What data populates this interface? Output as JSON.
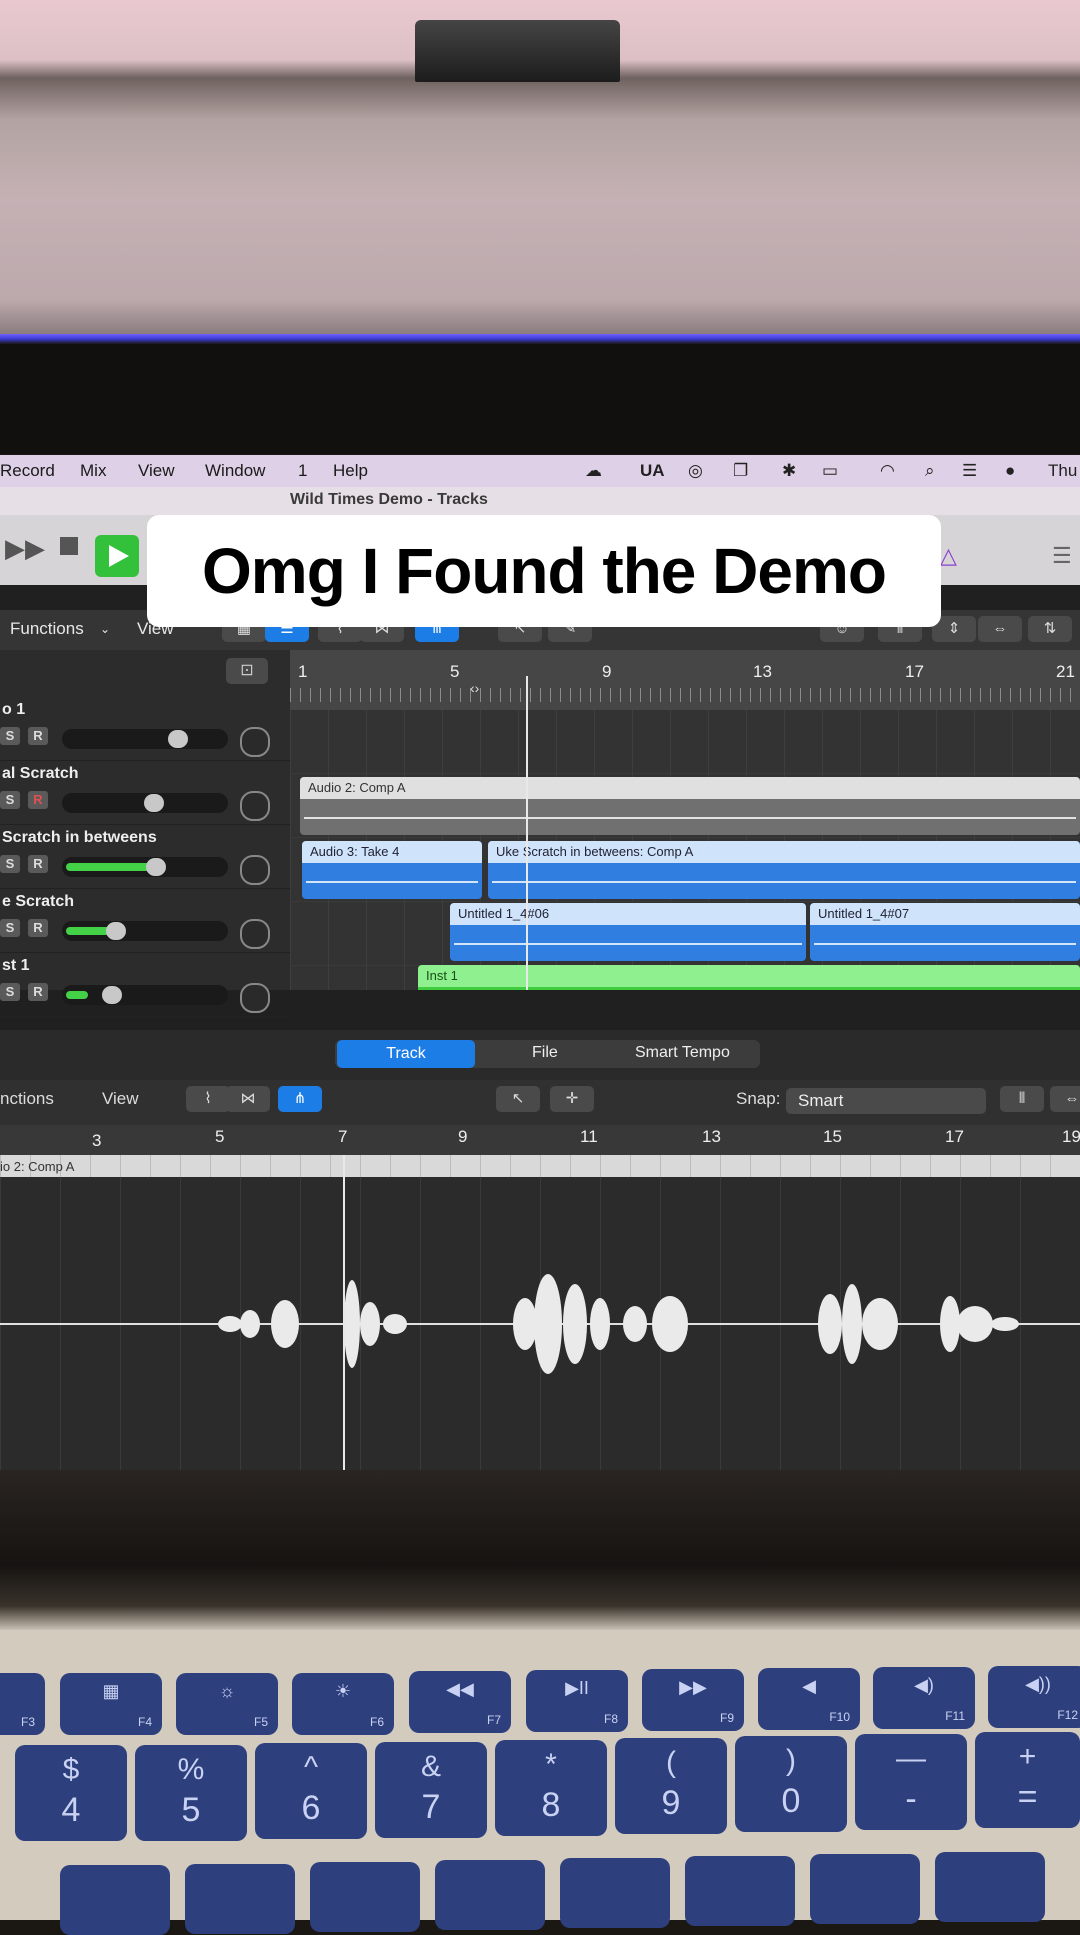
{
  "caption": "Omg I Found the Demo",
  "menubar": {
    "items": [
      "Record",
      "Mix",
      "View",
      "Window",
      "1",
      "Help"
    ],
    "status_text": "UA",
    "clock": "Thu"
  },
  "window": {
    "title": "Wild Times Demo - Tracks"
  },
  "toolbar1": {
    "functions": "Functions",
    "view": "View"
  },
  "ruler1": [
    "1",
    "5",
    "9",
    "13",
    "17",
    "21"
  ],
  "tracks": [
    {
      "name": "o 1",
      "solo": "S",
      "rec": "R",
      "level": 0.55
    },
    {
      "name": "al Scratch",
      "solo": "S",
      "rec": "R",
      "level": 0.45
    },
    {
      "name": "Scratch in betweens",
      "solo": "S",
      "rec": "R",
      "level": 0.45
    },
    {
      "name": "e Scratch",
      "solo": "S",
      "rec": "R",
      "level": 0.25
    },
    {
      "name": "st 1",
      "solo": "S",
      "rec": "R",
      "level": 0.2
    }
  ],
  "regions": {
    "audio2": "Audio 2: Comp A",
    "audio3": "Audio 3: Take 4",
    "uke": "Uke Scratch in betweens: Comp A",
    "untitled6": "Untitled 1_4#06",
    "untitled7": "Untitled 1_4#07",
    "inst": "Inst 1"
  },
  "editor_tabs": {
    "track": "Track",
    "file": "File",
    "smart_tempo": "Smart Tempo"
  },
  "toolbar2": {
    "functions": "nctions",
    "view": "View",
    "snap_label": "Snap:",
    "snap_value": "Smart"
  },
  "ruler2": [
    "3",
    "5",
    "7",
    "9",
    "11",
    "13",
    "15",
    "17",
    "19"
  ],
  "editor_region": "io 2: Comp A",
  "fkeys": [
    {
      "icon": "",
      "label": "F3"
    },
    {
      "icon": "▦",
      "label": "F4"
    },
    {
      "icon": "☼",
      "label": "F5"
    },
    {
      "icon": "☀",
      "label": "F6"
    },
    {
      "icon": "◀◀",
      "label": "F7"
    },
    {
      "icon": "▶II",
      "label": "F8"
    },
    {
      "icon": "▶▶",
      "label": "F9"
    },
    {
      "icon": "◀",
      "label": "F10"
    },
    {
      "icon": "◀)",
      "label": "F11"
    },
    {
      "icon": "◀))",
      "label": "F12"
    }
  ],
  "numkeys": [
    {
      "top": "$",
      "bot": "4"
    },
    {
      "top": "%",
      "bot": "5"
    },
    {
      "top": "^",
      "bot": "6"
    },
    {
      "top": "&",
      "bot": "7"
    },
    {
      "top": "*",
      "bot": "8"
    },
    {
      "top": "(",
      "bot": "9"
    },
    {
      "top": ")",
      "bot": "0"
    },
    {
      "top": "—",
      "bot": "-"
    },
    {
      "top": "+",
      "bot": "="
    }
  ]
}
